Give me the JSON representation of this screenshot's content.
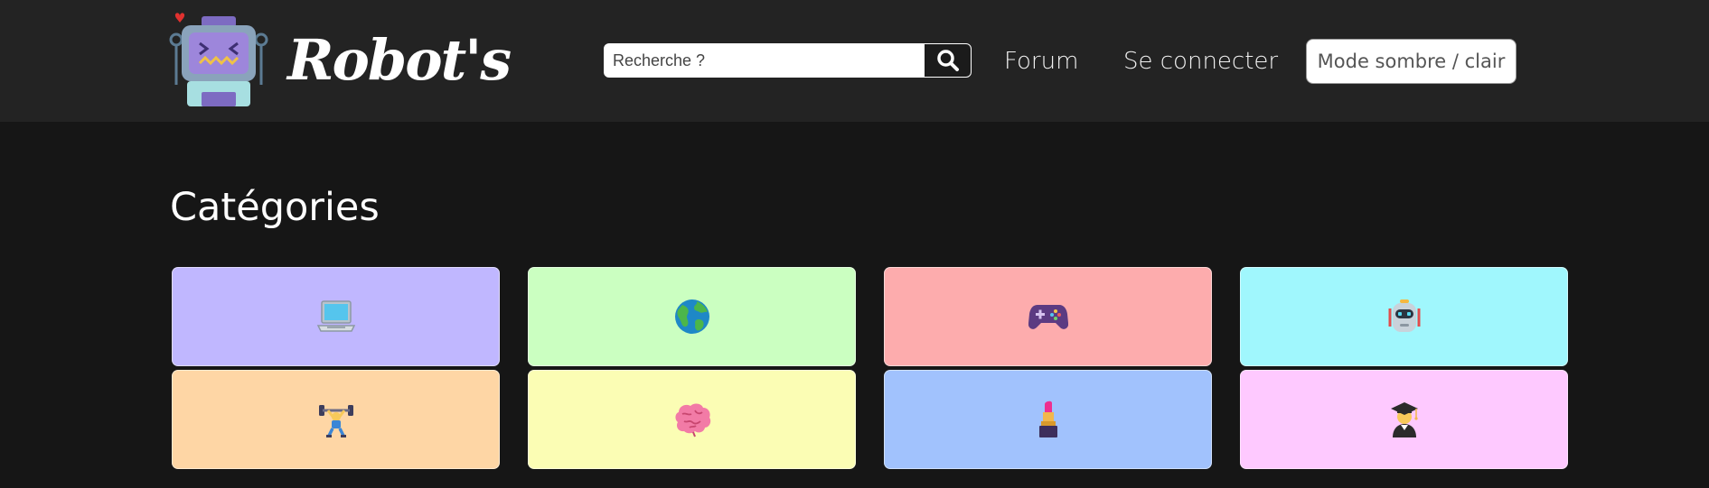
{
  "header": {
    "brand": "Robot's",
    "search": {
      "placeholder": "Recherche ?",
      "value": ""
    },
    "nav": {
      "forum": "Forum",
      "login": "Se connecter"
    },
    "mode_toggle": "Mode sombre / clair"
  },
  "main": {
    "title": "Catégories",
    "categories": [
      {
        "icon": "laptop-icon",
        "color": "#c0b7ff"
      },
      {
        "icon": "globe-icon",
        "color": "#cbffc1"
      },
      {
        "icon": "game-controller-icon",
        "color": "#fdacad"
      },
      {
        "icon": "robot-icon",
        "color": "#a0f7fd"
      },
      {
        "icon": "weightlifter-icon",
        "color": "#fed6a5"
      },
      {
        "icon": "brain-icon",
        "color": "#fbfdb4"
      },
      {
        "icon": "lipstick-icon",
        "color": "#a1c2fd"
      },
      {
        "icon": "graduate-icon",
        "color": "#fec9ff"
      }
    ]
  }
}
